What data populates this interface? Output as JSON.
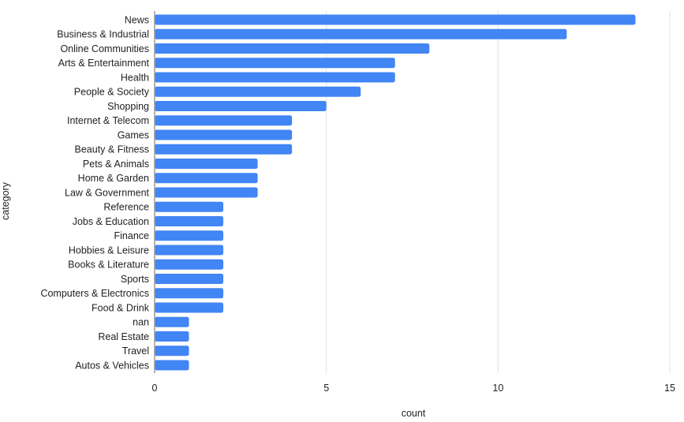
{
  "chart_data": {
    "type": "bar",
    "orientation": "horizontal",
    "title": "",
    "xlabel": "count",
    "ylabel": "category",
    "xlim": [
      0,
      15
    ],
    "xticks": [
      0,
      5,
      10,
      15
    ],
    "grid": true,
    "legend": "none",
    "bar_color": "#4285f4",
    "categories": [
      "News",
      "Business & Industrial",
      "Online Communities",
      "Arts & Entertainment",
      "Health",
      "People & Society",
      "Shopping",
      "Internet & Telecom",
      "Games",
      "Beauty & Fitness",
      "Pets & Animals",
      "Home & Garden",
      "Law & Government",
      "Reference",
      "Jobs & Education",
      "Finance",
      "Hobbies & Leisure",
      "Books & Literature",
      "Sports",
      "Computers & Electronics",
      "Food & Drink",
      "nan",
      "Real Estate",
      "Travel",
      "Autos & Vehicles"
    ],
    "values": [
      14,
      12,
      8,
      7,
      7,
      6,
      5,
      4,
      4,
      4,
      3,
      3,
      3,
      2,
      2,
      2,
      2,
      2,
      2,
      2,
      2,
      1,
      1,
      1,
      1
    ]
  }
}
